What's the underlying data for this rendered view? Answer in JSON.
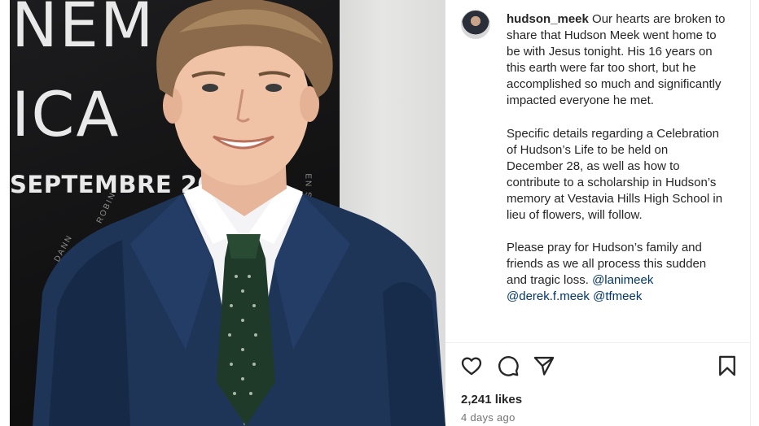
{
  "post": {
    "image": {
      "poster_line_1": "NEM",
      "poster_line_2": "ICA",
      "poster_line_3": "SEPTEMBRE 20",
      "poster_side_1": "DANN",
      "poster_side_2": "EN SIT",
      "poster_side_3": "ROBIN"
    },
    "author": {
      "username": "hudson_meek"
    },
    "caption": {
      "paragraph_1": "Our hearts are broken to share that Hudson Meek went home to be with Jesus tonight. His 16 years on this earth were far too short, but he accomplished so much and significantly impacted everyone he met.",
      "paragraph_2": "Specific details regarding a Celebration of Hudson’s Life to be held on December 28, as well as how to contribute to a scholarship in Hudson’s memory at Vestavia Hills High School in lieu of flowers, will follow.",
      "paragraph_3": "Please pray for Hudson’s family and friends as we all process this sudden and tragic loss.",
      "mentions": [
        "@lanimeek",
        "@derek.f.meek",
        "@tfmeek"
      ]
    },
    "actions": {
      "like_icon": "heart-outline",
      "comment_icon": "speech-bubble",
      "share_icon": "paper-plane",
      "save_icon": "bookmark-outline"
    },
    "likes_text": "2,241 likes",
    "timestamp_text": "4 days ago"
  },
  "colors": {
    "text": "#262626",
    "mention": "#00376b",
    "secondary": "#737373",
    "divider": "#efefef"
  }
}
